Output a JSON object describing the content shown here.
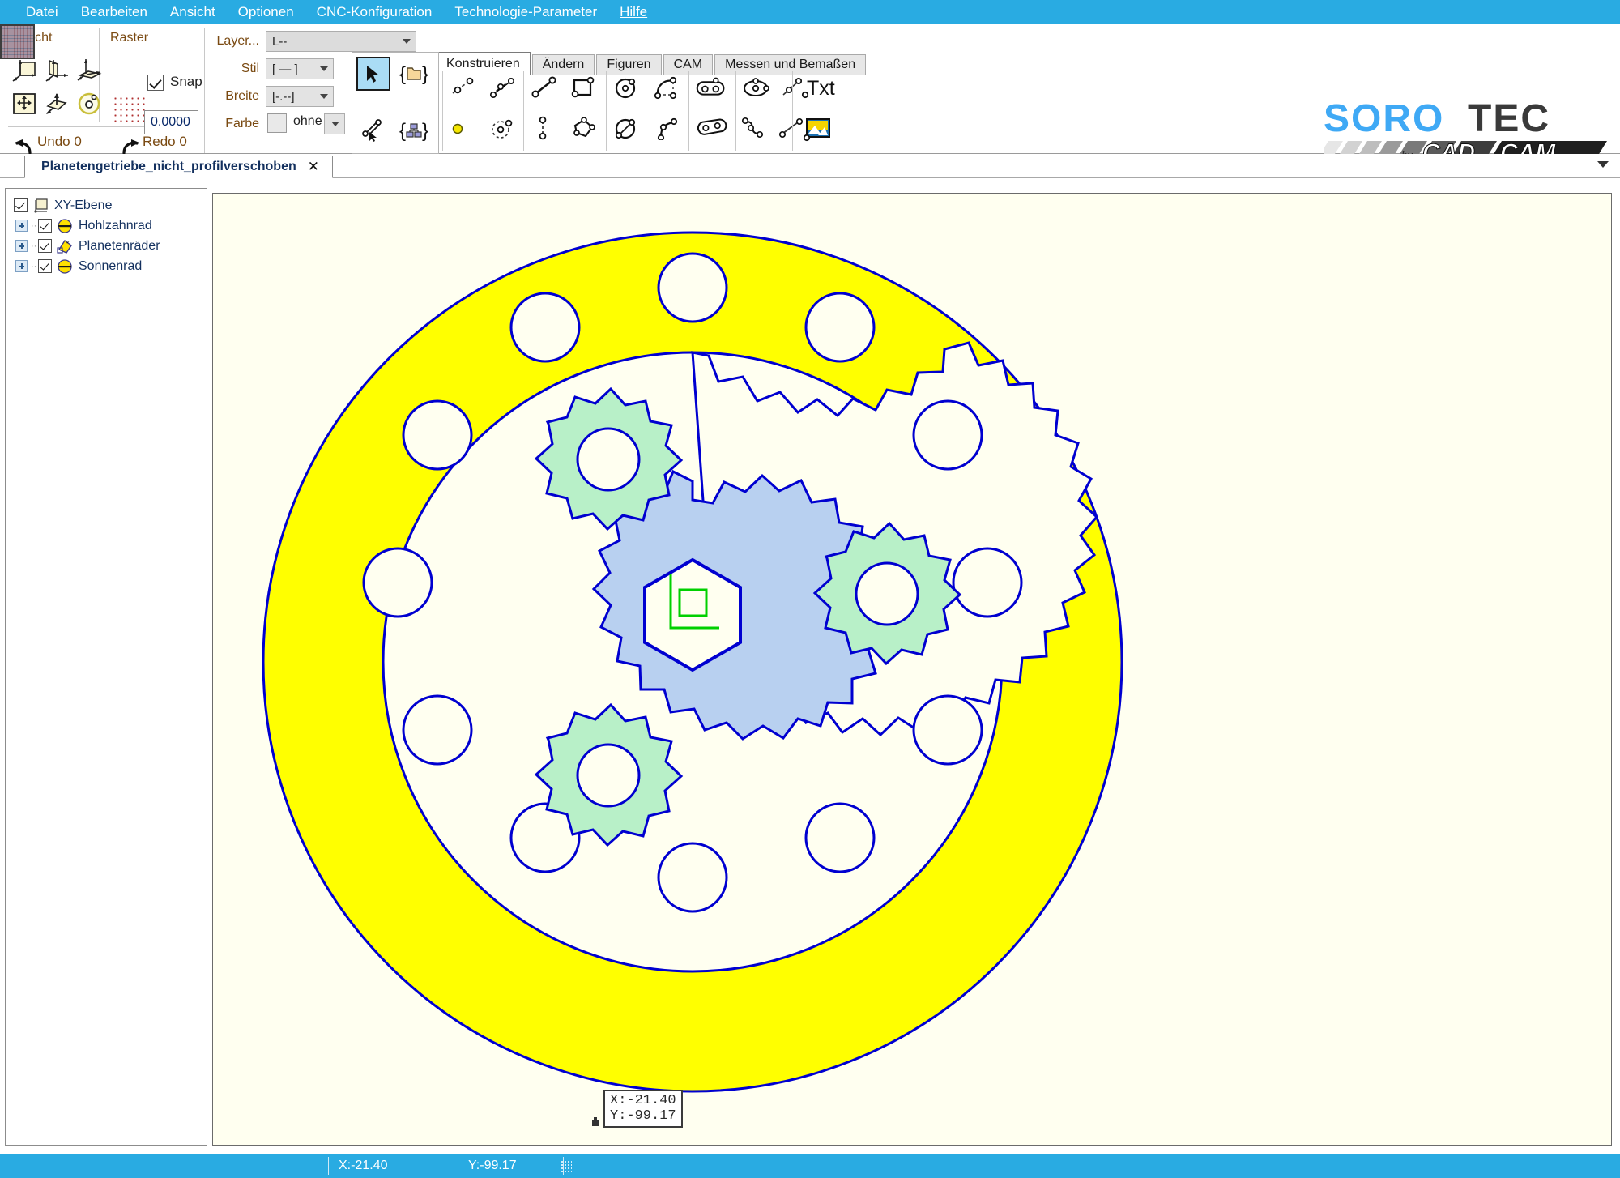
{
  "menubar": {
    "items": [
      {
        "label": "Datei"
      },
      {
        "label": "Bearbeiten"
      },
      {
        "label": "Ansicht"
      },
      {
        "label": "Optionen"
      },
      {
        "label": "CNC-Konfiguration"
      },
      {
        "label": "Technologie-Parameter"
      },
      {
        "label": "Hilfe"
      }
    ]
  },
  "ribbon": {
    "view_group_label": "Ansicht",
    "raster_group_label": "Raster",
    "snap_label": "Snap",
    "snap_value": "0.0000",
    "undo_label": "Undo 0",
    "redo_label": "Redo 0",
    "layer_label": "Layer...",
    "layer_value": "L--",
    "stil_label": "Stil",
    "stil_value": "[ — ]",
    "breite_label": "Breite",
    "breite_value": "[-.--]",
    "farbe_label": "Farbe",
    "farbe_value": "ohne",
    "tabs": [
      {
        "label": "Konstruieren",
        "active": true
      },
      {
        "label": "Ändern",
        "active": false
      },
      {
        "label": "Figuren",
        "active": false
      },
      {
        "label": "CAM",
        "active": false
      },
      {
        "label": "Messen und Bemaßen",
        "active": false
      }
    ],
    "text_tool_label": "Txt"
  },
  "logo": {
    "brand_main": "SOROTEC",
    "brand_sub": "by CAD as CAM",
    "accent_color": "#3FA9F5",
    "dark_color": "#3a3a3a"
  },
  "document": {
    "tab_title": "Planetengetriebe_nicht_profilverschoben",
    "close_glyph": "✕"
  },
  "tree": {
    "items": [
      {
        "label": "XY-Ebene",
        "icon": "plane-icon",
        "level": 0,
        "checked": true,
        "expandable": false
      },
      {
        "label": "Hohlzahnrad",
        "icon": "yellow-disc-icon",
        "level": 1,
        "checked": true,
        "expandable": true
      },
      {
        "label": "Planetenräder",
        "icon": "yellow-polygon-icon",
        "level": 1,
        "checked": true,
        "expandable": true
      },
      {
        "label": "Sonnenrad",
        "icon": "yellow-disc-icon",
        "level": 1,
        "checked": true,
        "expandable": true
      }
    ]
  },
  "canvas": {
    "background_color": "#FFFFF0",
    "outline_color": "#0000D0",
    "ring_fill": "#FFFF00",
    "sun_fill": "#B8D0F0",
    "planet_fill": "#B8F0C8",
    "marker_color": "#00D000",
    "tooltip_x": "X:-21.40",
    "tooltip_y": "Y:-99.17"
  },
  "statusbar": {
    "x_value": "X:-21.40",
    "y_value": "Y:-99.17"
  }
}
